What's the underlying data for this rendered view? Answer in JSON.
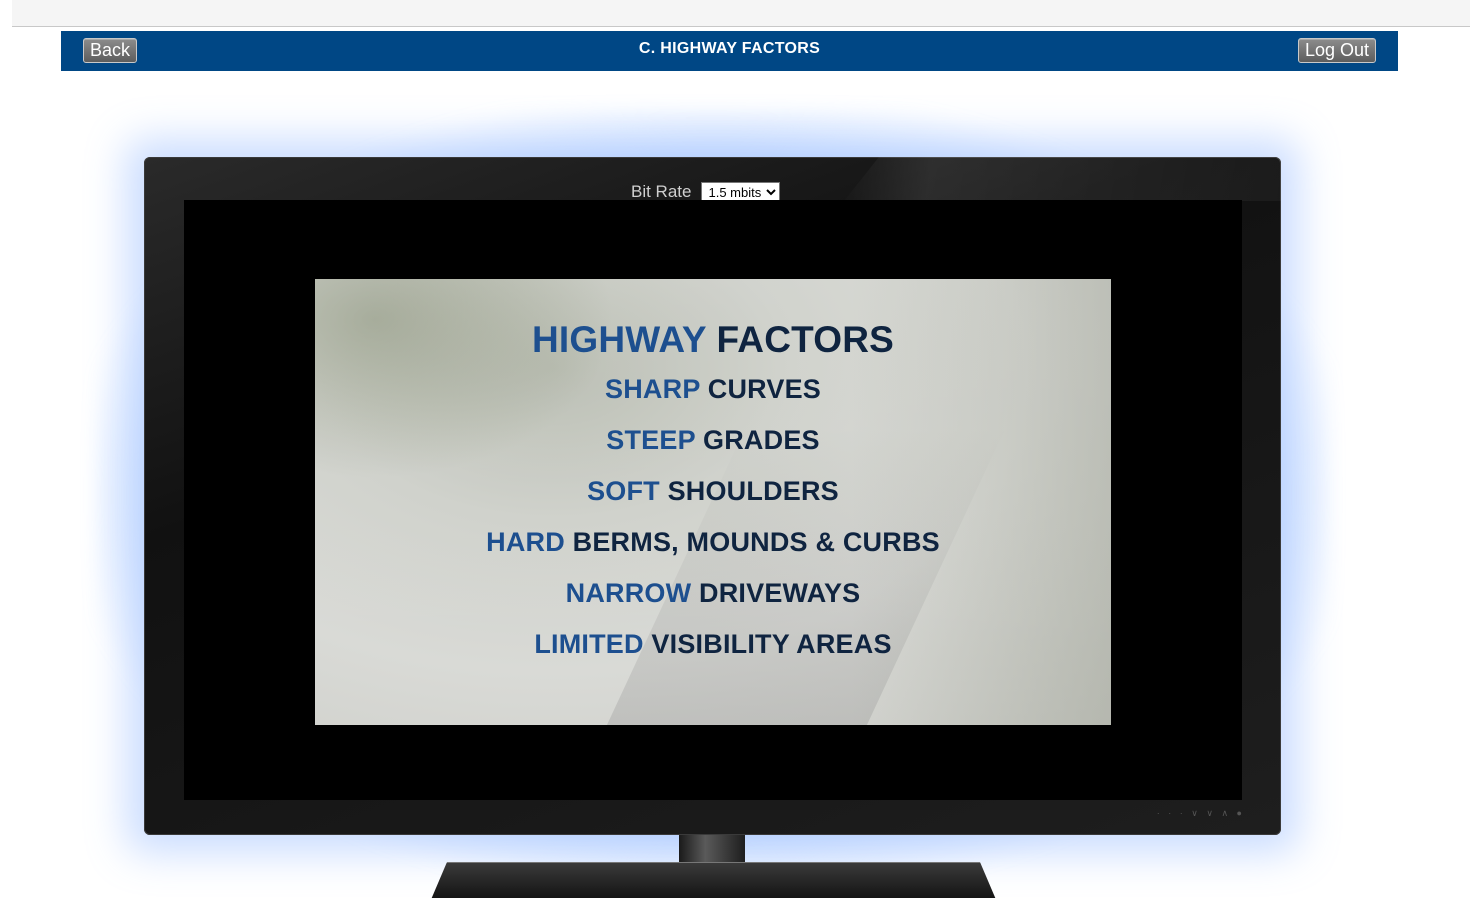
{
  "header": {
    "back_label": "Back",
    "title": "C. HIGHWAY FACTORS",
    "logout_label": "Log Out"
  },
  "player": {
    "bitrate_label": "Bit Rate",
    "bitrate_selected": "1.5 mbits"
  },
  "slide": {
    "title_accent": "HIGHWAY",
    "title_rest": "FACTORS",
    "items": [
      {
        "accent": "SHARP",
        "rest": "CURVES"
      },
      {
        "accent": "STEEP",
        "rest": "GRADES"
      },
      {
        "accent": "SOFT",
        "rest": "SHOULDERS"
      },
      {
        "accent": "HARD",
        "rest": "BERMS, MOUNDS & CURBS"
      },
      {
        "accent": "NARROW",
        "rest": "DRIVEWAYS"
      },
      {
        "accent": "LIMITED",
        "rest": "VISIBILITY AREAS"
      }
    ]
  },
  "colors": {
    "header_bg": "#004785",
    "accent_blue": "#1d4f8f",
    "dark_navy": "#0f2440"
  }
}
